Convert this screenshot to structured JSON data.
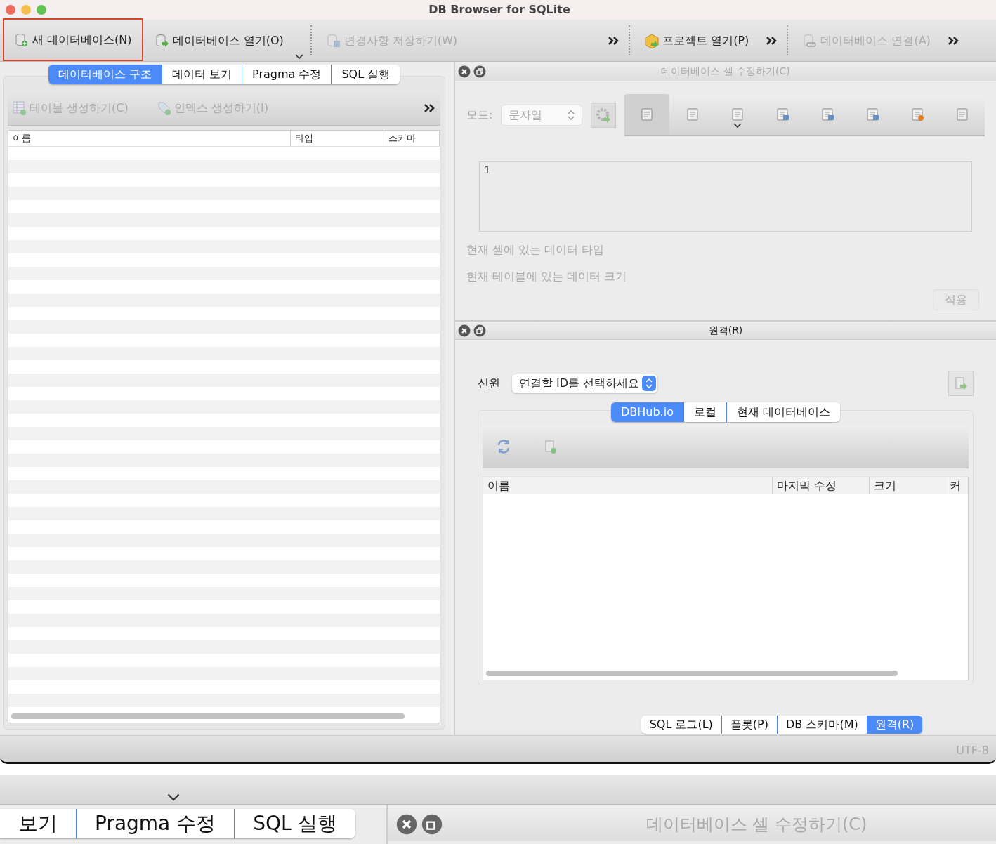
{
  "window": {
    "title": "DB Browser for SQLite"
  },
  "toolbar": [
    {
      "label": "새 데이터베이스(N)",
      "disabled": false,
      "highlighted": true
    },
    {
      "label": "데이터베이스 열기(O)",
      "disabled": false,
      "highlighted": false,
      "dropdown": true
    },
    {
      "label": "변경사항 저장하기(W)",
      "disabled": true,
      "highlighted": false,
      "overflow": true
    },
    {
      "label": "프로젝트 열기(P)",
      "disabled": false,
      "highlighted": false,
      "overflow": true
    },
    {
      "label": "데이터베이스 연결(A)",
      "disabled": true,
      "highlighted": false,
      "overflow": true
    }
  ],
  "left_panel": {
    "tabs": [
      {
        "label": "데이터베이스 구조",
        "selected": true
      },
      {
        "label": "데이터 보기",
        "selected": false
      },
      {
        "label": "Pragma 수정",
        "selected": false
      },
      {
        "label": "SQL 실행",
        "selected": false
      }
    ],
    "actions": [
      {
        "label": "테이블 생성하기(C)",
        "disabled": true
      },
      {
        "label": "인덱스 생성하기(I)",
        "disabled": true
      }
    ],
    "columns": [
      "이름",
      "타입",
      "스키마"
    ]
  },
  "edit_cell": {
    "title": "데이터베이스 셀 수정하기(C)",
    "mode_label": "모드:",
    "mode": "문자열",
    "disabled": true,
    "value": "1",
    "info": [
      "현재 셀에 있는 데이터 타입",
      "현재 테이블에 있는 데이터 크기"
    ],
    "apply": "적용"
  },
  "remote": {
    "title": "원격(R)",
    "source_label": "신원",
    "source": "연결할 ID를 선택하세요",
    "tabs": [
      {
        "label": "DBHub.io",
        "selected": true
      },
      {
        "label": "로컬",
        "selected": false
      },
      {
        "label": "현재 데이터베이스",
        "selected": false
      }
    ],
    "columns": [
      "이름",
      "마지막 수정",
      "크기",
      "커"
    ]
  },
  "bottom_tabs": [
    {
      "label": "SQL 로그(L)",
      "selected": false
    },
    {
      "label": "플롯(P)",
      "selected": false
    },
    {
      "label": "DB 스키마(M)",
      "selected": false
    },
    {
      "label": "원격(R)",
      "selected": true
    }
  ],
  "status_bar": {
    "encoding": "UTF-8"
  },
  "zoomed_copy": {
    "tabs": [
      {
        "label": "보기",
        "selected": false
      },
      {
        "label": "Pragma 수정",
        "selected": false
      },
      {
        "label": "SQL 실행",
        "selected": false
      }
    ],
    "panel_title": "데이터베이스 셀 수정하기(C)"
  }
}
